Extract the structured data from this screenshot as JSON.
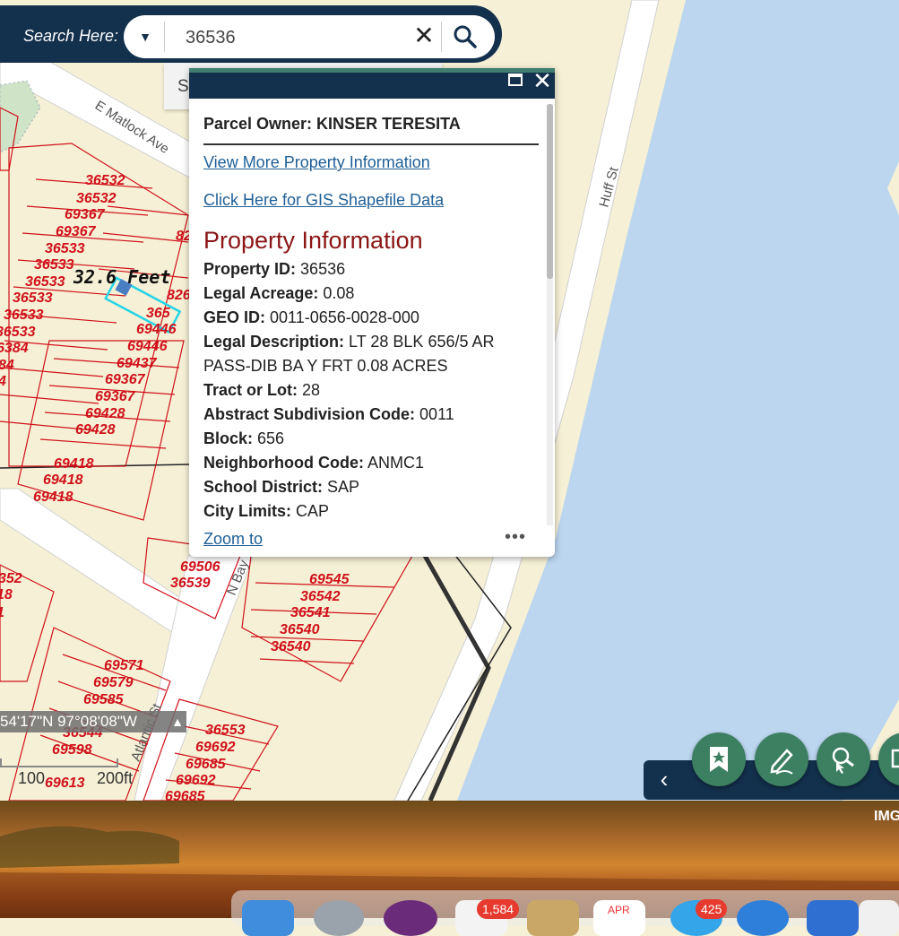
{
  "search": {
    "label": "Search Here:",
    "value": "36536",
    "dropdown_icon": "chevron-down-icon",
    "clear_icon": "close-icon",
    "submit_icon": "search-icon",
    "suggestion": "S"
  },
  "popup": {
    "owner_title": "Parcel Owner: KINSER TERESITA",
    "link_more": "View More Property Information",
    "link_gis": "Click Here for GIS Shapefile Data",
    "section_heading": "Property Information",
    "fields": [
      {
        "label": "Property ID:",
        "value": "36536"
      },
      {
        "label": "Legal Acreage:",
        "value": "0.08"
      },
      {
        "label": "GEO ID:",
        "value": "0011-0656-0028-000"
      },
      {
        "label": "Legal Description:",
        "value": "LT 28 BLK 656/5 AR"
      },
      {
        "label": "",
        "value": "PASS-DIB BA Y FRT 0.08 ACRES"
      },
      {
        "label": "Tract or Lot:",
        "value": "28"
      },
      {
        "label": "Abstract Subdivision Code:",
        "value": "0011"
      },
      {
        "label": "Block:",
        "value": "656"
      },
      {
        "label": "Neighborhood Code:",
        "value": "ANMC1"
      },
      {
        "label": "School District:",
        "value": "SAP"
      },
      {
        "label": "City Limits:",
        "value": "CAP"
      }
    ],
    "zoom_to": "Zoom to",
    "more": "•••"
  },
  "map": {
    "streets": [
      "E Matlock Ave",
      "Huff St",
      "N Bay",
      "Atlantic St"
    ],
    "measure_label": "32.6 Feet",
    "parcel_labels": {
      "left": [
        "36532",
        "36532",
        "69367",
        "69367",
        "36533",
        "36533",
        "36533",
        "36533",
        "36533",
        "36533",
        "6384",
        "84",
        "4"
      ],
      "center": [
        "69446",
        "69446",
        "69437",
        "69367",
        "69367",
        "69428",
        "69428"
      ],
      "bottom_left": [
        "69418",
        "69418",
        "69418"
      ],
      "mid": [
        "69506",
        "36539"
      ],
      "right": [
        "69545",
        "36542",
        "36541",
        "36540",
        "36540"
      ],
      "lower": [
        "69571",
        "69579",
        "69585",
        "36544",
        "69598",
        "69613"
      ],
      "lower_right": [
        "36553",
        "69692",
        "69685",
        "69692",
        "69685"
      ],
      "edge": [
        "352",
        "18",
        "1",
        "82",
        "826",
        "365"
      ]
    },
    "coordinates": "54'17\"N 97°08'08\"W",
    "scale": [
      "100",
      "200ft"
    ]
  },
  "toolbar": {
    "collapse_icon": "chevron-left-icon",
    "buttons": [
      "bookmark-icon",
      "edit-pencil-icon",
      "search-tool-icon",
      "calendar-icon"
    ]
  },
  "desktop": {
    "image_label": "IMG",
    "dock_badges": [
      "1,584",
      "425"
    ],
    "calendar_month": "APR"
  },
  "colors": {
    "navy": "#13304d",
    "green": "#3c7f61",
    "land": "#f6f1d6",
    "water": "#bcd6ef",
    "parcel": "#d0111b",
    "link": "#1f5f96",
    "heading": "#8b1616"
  }
}
